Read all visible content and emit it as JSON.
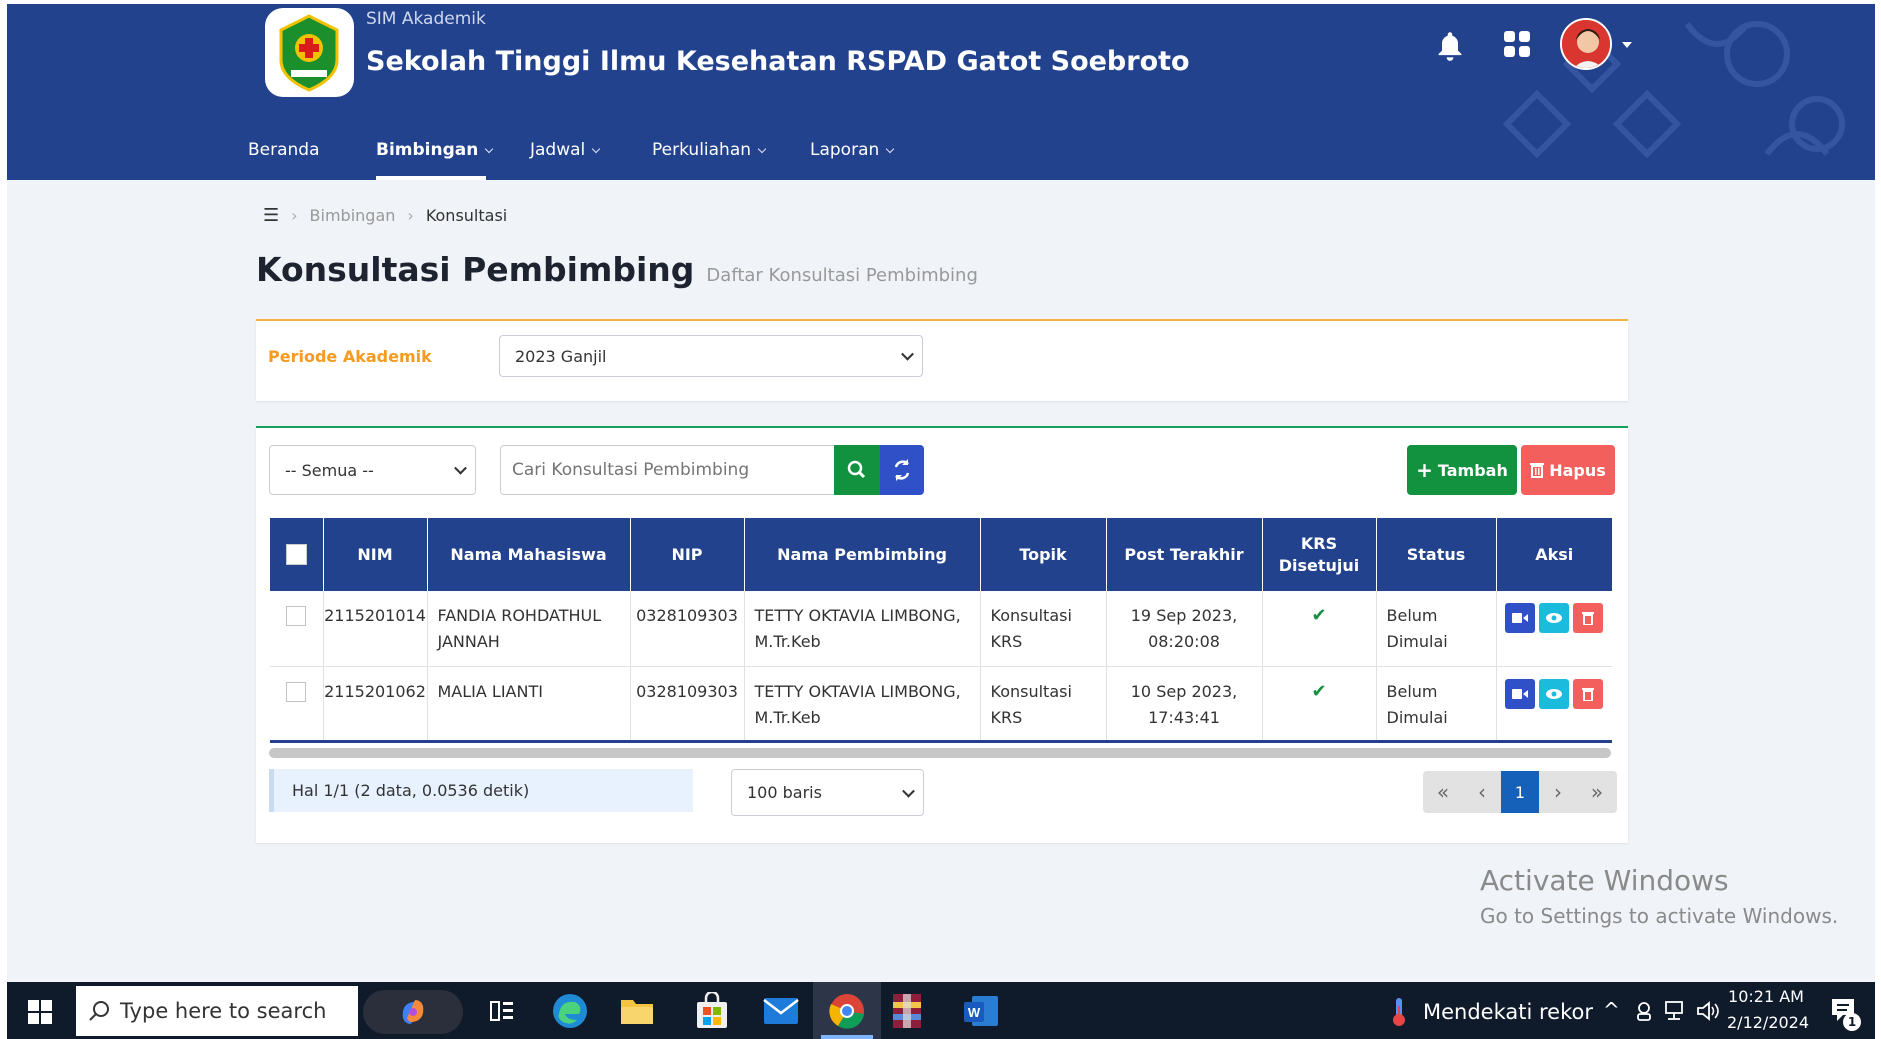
{
  "header": {
    "app_subtitle": "SIM Akademik",
    "institution": "Sekolah Tinggi Ilmu Kesehatan RSPAD Gatot Soebroto",
    "icons": [
      "bell-icon",
      "grid-icon",
      "avatar"
    ]
  },
  "nav": {
    "items": [
      {
        "label": "Beranda"
      },
      {
        "label": "Bimbingan"
      },
      {
        "label": "Jadwal"
      },
      {
        "label": "Perkuliahan"
      },
      {
        "label": "Laporan"
      }
    ]
  },
  "breadcrumb": {
    "items": [
      "Bimbingan",
      "Konsultasi"
    ]
  },
  "page": {
    "title": "Konsultasi Pembimbing",
    "subtitle": "Daftar Konsultasi Pembimbing"
  },
  "filter": {
    "periode_label": "Periode Akademik",
    "periode_value": "2023 Ganjil"
  },
  "toolbar": {
    "status_filter": "-- Semua --",
    "search_placeholder": "Cari Konsultasi Pembimbing",
    "add_label": "Tambah",
    "delete_label": "Hapus"
  },
  "table": {
    "headers": [
      "NIM",
      "Nama Mahasiswa",
      "NIP",
      "Nama Pembimbing",
      "Topik",
      "Post Terakhir",
      "KRS Disetujui",
      "Status",
      "Aksi"
    ],
    "rows": [
      {
        "nim": "2115201014",
        "nama": "FANDIA ROHDATHUL JANNAH",
        "nip": "0328109303",
        "pembimbing": "TETTY OKTAVIA LIMBONG, M.Tr.Keb",
        "topik": "Konsultasi KRS",
        "post": "19 Sep 2023, 08:20:08",
        "krs": "✔",
        "status": "Belum Dimulai"
      },
      {
        "nim": "2115201062",
        "nama": "MALIA LIANTI",
        "nip": "0328109303",
        "pembimbing": "TETTY OKTAVIA LIMBONG, M.Tr.Keb",
        "topik": "Konsultasi KRS",
        "post": "10 Sep 2023, 17:43:41",
        "krs": "✔",
        "status": "Belum Dimulai"
      }
    ]
  },
  "footer": {
    "info": "Hal 1/1 (2 data, 0.0536 detik)",
    "rows_per_page": "100 baris",
    "pagination": {
      "first": "«",
      "prev": "‹",
      "current": "1",
      "next": "›",
      "last": "»"
    }
  },
  "watermark": {
    "line1": "Activate Windows",
    "line2": "Go to Settings to activate Windows."
  },
  "taskbar": {
    "search_placeholder": "Type here to search",
    "weather": "Mendekati rekor",
    "time": "10:21 AM",
    "date": "2/12/2024",
    "notification_count": "1"
  },
  "colors": {
    "primary": "#23428e",
    "accent": "#f59b1f",
    "success": "#12923f",
    "danger": "#f25f5c",
    "info": "#1bbbdd"
  }
}
